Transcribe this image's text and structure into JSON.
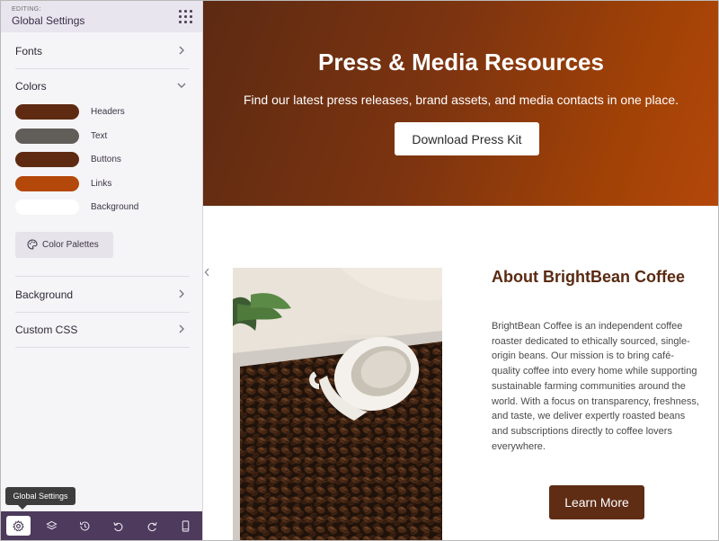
{
  "sidebar": {
    "editing_label": "EDITING:",
    "title": "Global Settings",
    "sections": {
      "fonts": "Fonts",
      "colors": "Colors",
      "background": "Background",
      "custom_css": "Custom CSS"
    },
    "colors": [
      {
        "label": "Headers",
        "color": "#5e2b12"
      },
      {
        "label": "Text",
        "color": "#615d59"
      },
      {
        "label": "Buttons",
        "color": "#5e2b12"
      },
      {
        "label": "Links",
        "color": "#b4470a"
      },
      {
        "label": "Background",
        "color": "#ffffff"
      }
    ],
    "palettes_button": "Color Palettes",
    "tooltip": "Global Settings",
    "toolbar_icons": [
      "gear-icon",
      "layers-icon",
      "history-icon",
      "undo-icon",
      "redo-icon",
      "mobile-preview-icon"
    ]
  },
  "hero": {
    "title": "Press & Media Resources",
    "subtitle": "Find our latest press releases, brand assets, and media contacts in one place.",
    "button": "Download Press Kit"
  },
  "about": {
    "title": "About BrightBean Coffee",
    "text": "BrightBean Coffee is an independent coffee roaster dedicated to ethically sourced, single-origin beans. Our mission is to bring café-quality coffee into every home while supporting sustainable farming communities around the world. With a focus on transparency, freshness, and taste, we deliver expertly roasted beans and subscriptions directly to coffee lovers everywhere.",
    "button": "Learn More"
  }
}
